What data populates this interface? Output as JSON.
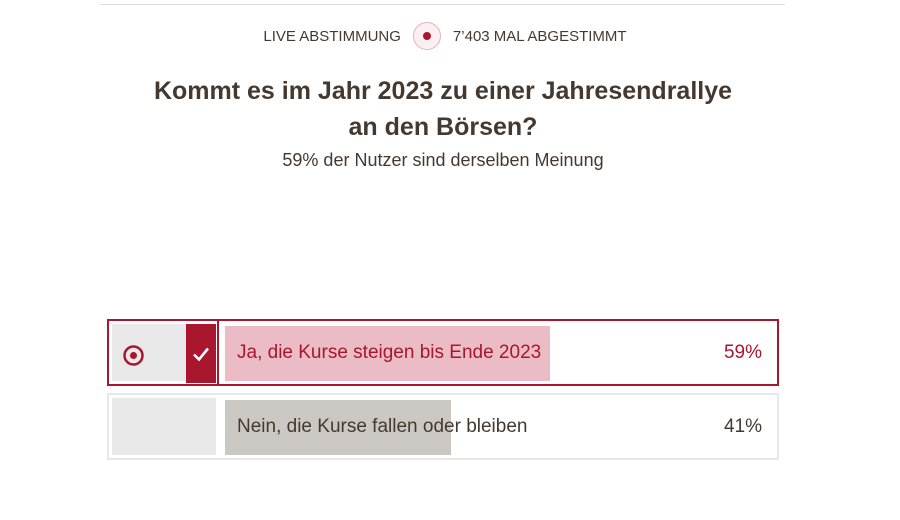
{
  "poll": {
    "status_label": "LIVE ABSTIMMUNG",
    "votes_label": "7’403 MAL ABGESTIMMT",
    "question_line1": "Kommt es im Jahr 2023 zu einer Jahresendrallye",
    "question_line2": "an den Börsen?",
    "agreement_text": "59% der Nutzer sind derselben Meinung",
    "colors": {
      "accent": "#a8172d",
      "selected_fill": "#ebbcc5",
      "other_fill": "#cbc7c3",
      "text": "#45392f"
    },
    "options": [
      {
        "label": "Ja, die Kurse steigen bis Ende 2023",
        "percent_label": "59%",
        "share": 0.59,
        "selected": true,
        "icons": [
          "target-icon",
          "check-icon"
        ]
      },
      {
        "label": "Nein, die Kurse fallen oder bleiben",
        "percent_label": "41%",
        "share": 0.41,
        "selected": false
      }
    ]
  }
}
